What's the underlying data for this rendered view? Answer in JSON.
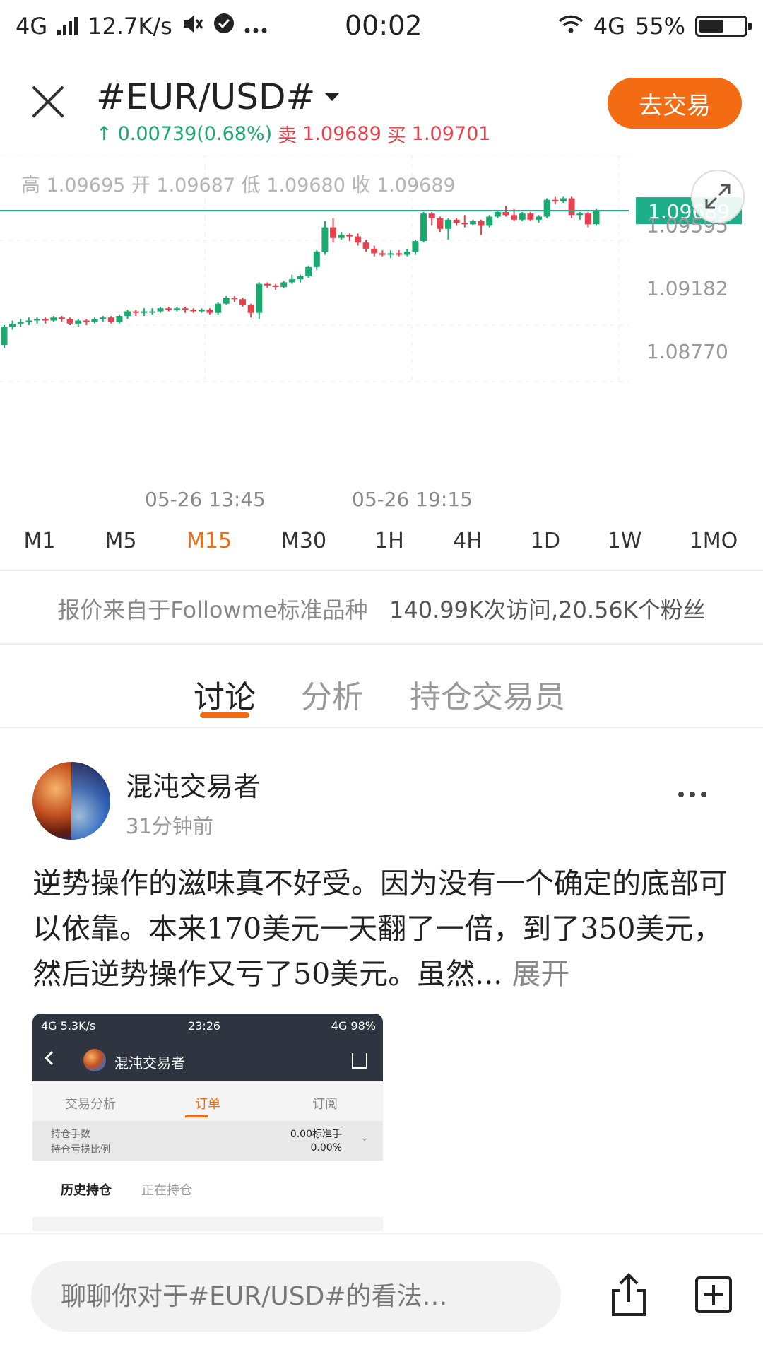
{
  "status_bar": {
    "network": "4G",
    "speed": "12.7K/s",
    "time": "00:02",
    "right_network": "4G",
    "battery": "55%",
    "battery_level": 0.55
  },
  "header": {
    "symbol": "#EUR/USD#",
    "change": "0.00739(0.68%)",
    "sell_label": "卖",
    "sell_price": "1.09689",
    "buy_label": "买",
    "buy_price": "1.09701",
    "trade_button": "去交易"
  },
  "chart": {
    "ohlc_text": "高 1.09695  开 1.09687  低 1.09680  收 1.09689",
    "current_price": "1.09689",
    "y_ticks": [
      "1.09595",
      "1.09182",
      "1.08770"
    ],
    "x_ticks": [
      "05-26 13:45",
      "05-26 19:15"
    ],
    "colors": {
      "up": "#1aa96e",
      "down": "#e5424d",
      "price_line": "#1fae8a"
    }
  },
  "chart_data": {
    "type": "candlestick",
    "x_ticks": [
      "05-26 13:45",
      "05-26 19:15"
    ],
    "ylim": [
      1.0857,
      1.1005
    ],
    "current": 1.09689,
    "candles": [
      [
        1.0881,
        1.0893,
        1.0879,
        1.0894
      ],
      [
        1.0893,
        1.0895,
        1.0891,
        1.0897
      ],
      [
        1.0895,
        1.0896,
        1.0893,
        1.0898
      ],
      [
        1.0896,
        1.0897,
        1.0894,
        1.0899
      ],
      [
        1.0897,
        1.0898,
        1.0895,
        1.0899
      ],
      [
        1.0898,
        1.0897,
        1.0895,
        1.0899
      ],
      [
        1.0897,
        1.0899,
        1.0896,
        1.09
      ],
      [
        1.0899,
        1.0898,
        1.0896,
        1.09
      ],
      [
        1.0898,
        1.0895,
        1.0894,
        1.0899
      ],
      [
        1.0895,
        1.0897,
        1.0893,
        1.0898
      ],
      [
        1.0897,
        1.0896,
        1.0894,
        1.0898
      ],
      [
        1.0896,
        1.0898,
        1.0895,
        1.0899
      ],
      [
        1.0898,
        1.0899,
        1.0896,
        1.09
      ],
      [
        1.0899,
        1.0896,
        1.0895,
        1.09
      ],
      [
        1.0896,
        1.09,
        1.0895,
        1.0901
      ],
      [
        1.09,
        1.0903,
        1.0898,
        1.0904
      ],
      [
        1.0903,
        1.0902,
        1.09,
        1.0904
      ],
      [
        1.0902,
        1.0903,
        1.09,
        1.0905
      ],
      [
        1.0903,
        1.0903,
        1.0901,
        1.0905
      ],
      [
        1.0903,
        1.0905,
        1.0902,
        1.0906
      ],
      [
        1.0905,
        1.0904,
        1.0903,
        1.0906
      ],
      [
        1.0904,
        1.0905,
        1.0903,
        1.0906
      ],
      [
        1.0905,
        1.0904,
        1.0902,
        1.0906
      ],
      [
        1.0904,
        1.0903,
        1.0902,
        1.0905
      ],
      [
        1.0903,
        1.0904,
        1.0902,
        1.0905
      ],
      [
        1.0904,
        1.0902,
        1.0901,
        1.0905
      ],
      [
        1.0902,
        1.0908,
        1.0901,
        1.0909
      ],
      [
        1.0908,
        1.0912,
        1.0907,
        1.0913
      ],
      [
        1.0912,
        1.0911,
        1.0909,
        1.0913
      ],
      [
        1.0911,
        1.0907,
        1.0906,
        1.0912
      ],
      [
        1.0907,
        1.0902,
        1.0899,
        1.0908
      ],
      [
        1.0902,
        1.0921,
        1.0898,
        1.0922
      ],
      [
        1.0921,
        1.092,
        1.0918,
        1.0922
      ],
      [
        1.092,
        1.0919,
        1.0917,
        1.0921
      ],
      [
        1.0919,
        1.0922,
        1.0918,
        1.0923
      ],
      [
        1.0922,
        1.0924,
        1.0921,
        1.0927
      ],
      [
        1.0924,
        1.0926,
        1.0922,
        1.0927
      ],
      [
        1.0926,
        1.0932,
        1.0925,
        1.0933
      ],
      [
        1.0932,
        1.0942,
        1.093,
        1.0943
      ],
      [
        1.0942,
        1.0958,
        1.094,
        1.0962
      ],
      [
        1.0958,
        1.0951,
        1.0948,
        1.0964
      ],
      [
        1.0951,
        1.0953,
        1.095,
        1.0955
      ],
      [
        1.0953,
        1.0952,
        1.0949,
        1.0954
      ],
      [
        1.0952,
        1.0948,
        1.0946,
        1.0954
      ],
      [
        1.0948,
        1.0944,
        1.0942,
        1.095
      ],
      [
        1.0944,
        1.0941,
        1.0939,
        1.0946
      ],
      [
        1.0941,
        1.094,
        1.0939,
        1.0943
      ],
      [
        1.094,
        1.0941,
        1.0938,
        1.0943
      ],
      [
        1.0941,
        1.094,
        1.0939,
        1.0943
      ],
      [
        1.094,
        1.0942,
        1.0939,
        1.0944
      ],
      [
        1.0942,
        1.0949,
        1.094,
        1.095
      ],
      [
        1.0949,
        1.0967,
        1.0948,
        1.0968
      ],
      [
        1.0967,
        1.0964,
        1.0959,
        1.0968
      ],
      [
        1.0964,
        1.0957,
        1.0955,
        1.0965
      ],
      [
        1.0957,
        1.0963,
        1.095,
        1.0964
      ],
      [
        1.0963,
        1.0961,
        1.0959,
        1.0964
      ],
      [
        1.0961,
        1.096,
        1.0958,
        1.0966
      ],
      [
        1.096,
        1.0962,
        1.0959,
        1.0963
      ],
      [
        1.0962,
        1.0959,
        1.0953,
        1.0963
      ],
      [
        1.0959,
        1.0965,
        1.0958,
        1.0966
      ],
      [
        1.0965,
        1.0968,
        1.0964,
        1.0969
      ],
      [
        1.0968,
        1.0966,
        1.0965,
        1.0972
      ],
      [
        1.0966,
        1.0963,
        1.0962,
        1.097
      ],
      [
        1.0963,
        1.0967,
        1.0962,
        1.0968
      ],
      [
        1.0967,
        1.0963,
        1.0962,
        1.0968
      ],
      [
        1.0963,
        1.0965,
        1.0961,
        1.0966
      ],
      [
        1.0965,
        1.0976,
        1.0964,
        1.0977
      ],
      [
        1.0976,
        1.0975,
        1.0973,
        1.0978
      ],
      [
        1.0975,
        1.0977,
        1.0974,
        1.0978
      ],
      [
        1.0977,
        1.0966,
        1.0964,
        1.0978
      ],
      [
        1.0966,
        1.0967,
        1.0963,
        1.0968
      ],
      [
        1.0967,
        1.096,
        1.0958,
        1.0968
      ],
      [
        1.096,
        1.0969,
        1.0959,
        1.097
      ]
    ]
  },
  "timeframes": {
    "items": [
      "M1",
      "M5",
      "M15",
      "M30",
      "1H",
      "4H",
      "1D",
      "1W",
      "1MO"
    ],
    "active": "M15"
  },
  "quote_source": {
    "text": "报价来自于Followme标准品种",
    "stats": "140.99K次访问,20.56K个粉丝"
  },
  "tabs": {
    "items": [
      "讨论",
      "分析",
      "持仓交易员"
    ],
    "active": "讨论"
  },
  "post": {
    "author": "混沌交易者",
    "time": "31分钟前",
    "body": "逆势操作的滋味真不好受。因为没有一个确定的底部可以依靠。本来170美元一天翻了一倍，到了350美元，然后逆势操作又亏了50美元。虽然...",
    "expand": "展开",
    "embed": {
      "status_left": "4G  5.3K/s",
      "status_time": "23:26",
      "status_right": "4G 98%",
      "name": "混沌交易者",
      "tabs": [
        "交易分析",
        "订单",
        "订阅"
      ],
      "stat_labels": [
        "持仓手数",
        "持仓亏损比例"
      ],
      "stat_values": [
        "0.00标准手",
        "0.00%"
      ],
      "history_tabs": [
        "历史持仓",
        "正在持仓"
      ]
    }
  },
  "bottom_bar": {
    "placeholder": "聊聊你对于#EUR/USD#的看法…"
  }
}
